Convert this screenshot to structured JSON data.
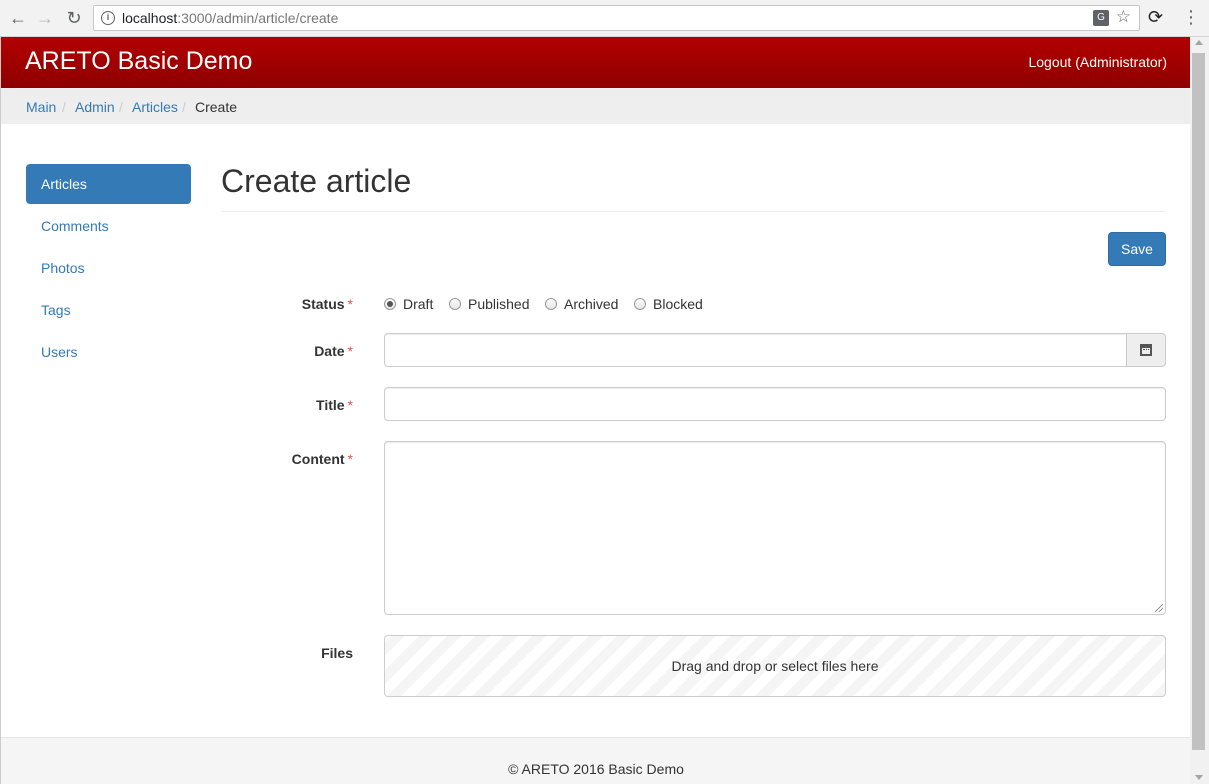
{
  "browser": {
    "url_host": "localhost",
    "url_path": ":3000/admin/article/create"
  },
  "navbar": {
    "brand": "ARETO Basic Demo",
    "logout": "Logout (Administrator)"
  },
  "breadcrumb": {
    "items": [
      "Main",
      "Admin",
      "Articles"
    ],
    "separator": "/",
    "active": "Create"
  },
  "sidebar": {
    "items": [
      {
        "label": "Articles",
        "active": true
      },
      {
        "label": "Comments"
      },
      {
        "label": "Photos"
      },
      {
        "label": "Tags"
      },
      {
        "label": "Users"
      }
    ]
  },
  "main": {
    "title": "Create article",
    "save_label": "Save"
  },
  "form": {
    "required_marker": "*",
    "status": {
      "label": "Status",
      "options": [
        "Draft",
        "Published",
        "Archived",
        "Blocked"
      ],
      "selected": "Draft"
    },
    "date": {
      "label": "Date",
      "value": ""
    },
    "title": {
      "label": "Title",
      "value": ""
    },
    "content": {
      "label": "Content",
      "value": ""
    },
    "files": {
      "label": "Files",
      "dropzone_text": "Drag and drop or select files here"
    }
  },
  "footer": {
    "text": "© ARETO 2016 Basic Demo"
  },
  "colors": {
    "navbar": "#a00000",
    "primary": "#337ab7",
    "required": "#d9534f"
  }
}
